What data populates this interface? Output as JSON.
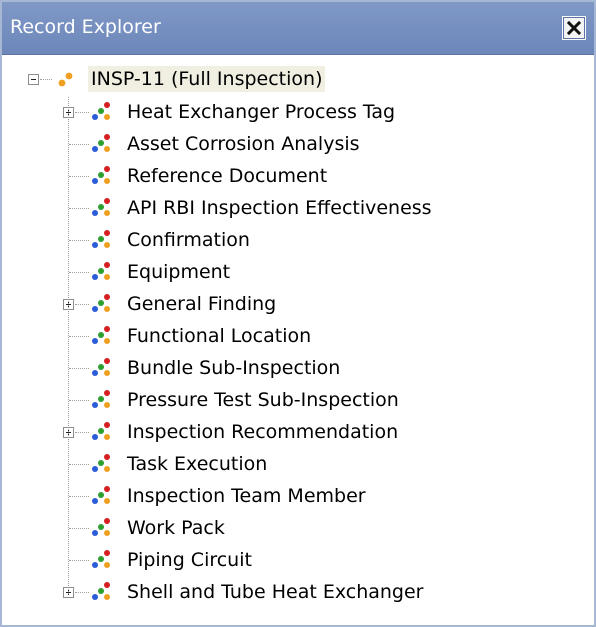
{
  "panel": {
    "title": "Record Explorer",
    "close_icon": "close-icon"
  },
  "tree": {
    "root": {
      "label": "INSP-11 (Full Inspection)",
      "expanded": true,
      "icon": "record-root-icon"
    },
    "children": [
      {
        "label": "Heat Exchanger Process Tag",
        "expandable": true
      },
      {
        "label": "Asset Corrosion Analysis",
        "expandable": false
      },
      {
        "label": "Reference Document",
        "expandable": false
      },
      {
        "label": "API RBI Inspection Effectiveness",
        "expandable": false
      },
      {
        "label": "Confirmation",
        "expandable": false
      },
      {
        "label": "Equipment",
        "expandable": false
      },
      {
        "label": "General Finding",
        "expandable": true
      },
      {
        "label": "Functional Location",
        "expandable": false
      },
      {
        "label": "Bundle Sub-Inspection",
        "expandable": false
      },
      {
        "label": "Pressure Test Sub-Inspection",
        "expandable": false
      },
      {
        "label": "Inspection Recommendation",
        "expandable": true
      },
      {
        "label": "Task Execution",
        "expandable": false
      },
      {
        "label": "Inspection Team Member",
        "expandable": false
      },
      {
        "label": "Work Pack",
        "expandable": false
      },
      {
        "label": "Piping Circuit",
        "expandable": false
      },
      {
        "label": "Shell and Tube Heat Exchanger",
        "expandable": true
      }
    ]
  },
  "colors": {
    "titlebar": "#7f98c6",
    "root_highlight": "#f1efe2",
    "dot_red": "#d42020",
    "dot_green": "#2ca02c",
    "dot_blue": "#2a5bd8",
    "dot_orange": "#f0a020"
  }
}
